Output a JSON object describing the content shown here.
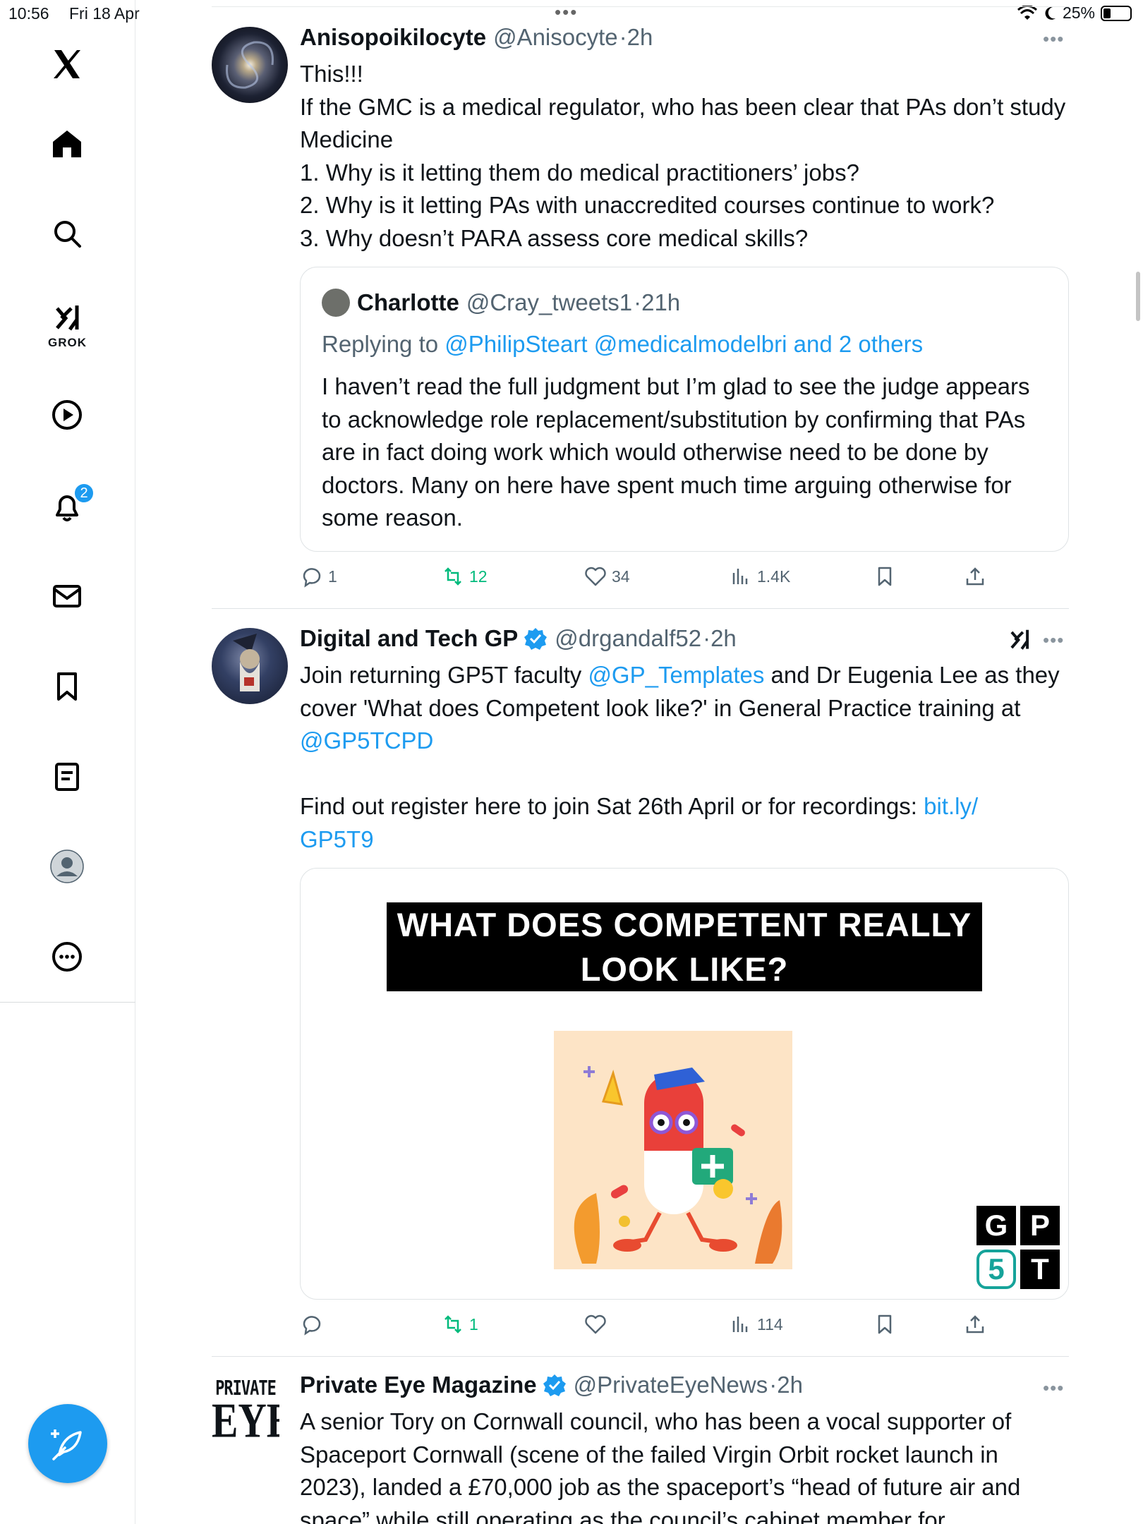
{
  "status_bar": {
    "time": "10:56",
    "date": "Fri 18 Apr",
    "battery": "25%",
    "battery_level": 0.25
  },
  "sidebar": {
    "grok_label": "GROK",
    "notifications_badge": "2",
    "items": [
      "x-logo",
      "home",
      "search",
      "grok",
      "video",
      "notifications",
      "messages",
      "bookmarks",
      "lists",
      "profile",
      "more"
    ]
  },
  "tweets": [
    {
      "name": "Anisopoikilocyte",
      "handle": "@Anisocyte",
      "time": "·2h",
      "text": "This!!!\nIf the GMC is a medical regulator, who has been clear that PAs don’t study Medicine\n1. Why is it letting them do medical practitioners’ jobs?\n2. Why is it letting PAs with unaccredited courses continue to work?\n3. Why doesn’t PARA assess core medical skills?",
      "quote": {
        "name": "Charlotte",
        "handle": "@Cray_tweets1",
        "time": "·21h",
        "replying_prefix": "Replying to ",
        "replying_to": "@PhilipSteart @medicalmodelbri and 2 others",
        "text": "I haven’t read the full judgment but I’m glad to see the judge appears to acknowledge role replacement/substitution by confirming that PAs are in fact doing work which would otherwise need to be done by doctors. Many on here have spent much time arguing otherwise for some reason."
      },
      "actions": {
        "replies": "1",
        "reposts": "12",
        "likes": "34",
        "views": "1.4K"
      }
    },
    {
      "name": "Digital and Tech GP",
      "handle": "@drgandalf52",
      "time": "·2h",
      "text_part1": "Join returning GP5T faculty ",
      "mention1": "@GP_Templates",
      "text_part2": " and Dr Eugenia Lee as they cover 'What does Competent look like?' in General Practice training at ",
      "mention2": "@GP5TCPD",
      "text_part3": "\n\nFind out register here to join Sat 26th April or for recordings: ",
      "url": "bit.ly/\nGP5T9",
      "media_banner": "WHAT DOES COMPETENT REALLY LOOK LIKE?",
      "logo_letters": [
        "G",
        "P",
        "5",
        "T"
      ],
      "actions": {
        "replies": "",
        "reposts": "1",
        "likes": "",
        "views": "114"
      }
    },
    {
      "name": "Private Eye Magazine",
      "handle": "@PrivateEyeNews",
      "time": "·2h",
      "avatar_text_top": "PRIVATE",
      "avatar_text_bottom": "EYE",
      "text": "A senior Tory on Cornwall council, who has been a vocal supporter of Spaceport Cornwall (scene of the failed Virgin Orbit rocket launch in 2023), landed a £70,000 job as the spaceport’s “head of future air and space” while still operating as the council’s cabinet member for"
    }
  ],
  "colors": {
    "accent": "#1d9bf0",
    "repost_green": "#00ba7c",
    "secondary_text": "#536471"
  }
}
